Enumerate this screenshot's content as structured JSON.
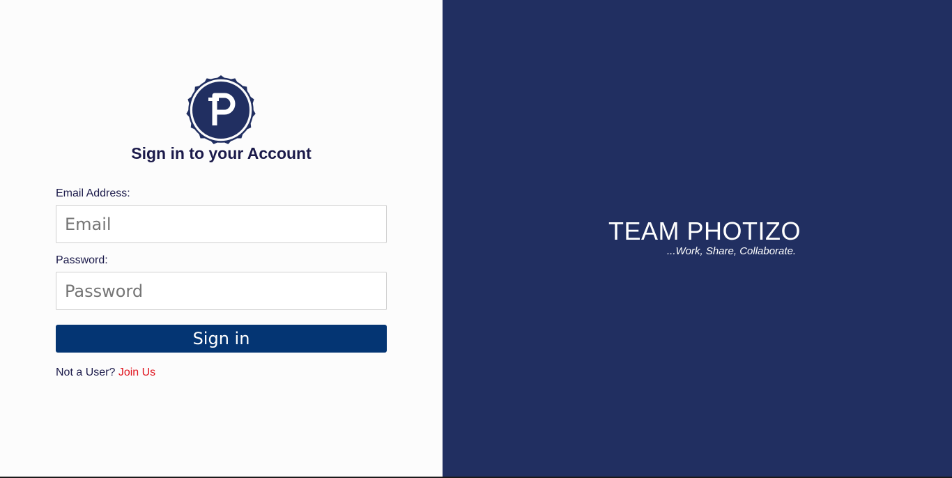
{
  "login": {
    "heading": "Sign in to your Account",
    "email_label": "Email Address:",
    "email_placeholder": "Email",
    "email_value": "",
    "password_label": "Password:",
    "password_placeholder": "Password",
    "password_value": "",
    "signin_label": "Sign in",
    "not_user_text": "Not a User?",
    "join_link": "Join Us",
    "logo_icon": "photizo-p-logo-icon"
  },
  "brand": {
    "title": "TEAM PHOTIZO",
    "tagline": "...Work, Share, Collaborate."
  },
  "colors": {
    "primary": "#212f61",
    "button": "#043573",
    "link": "#e0141e",
    "text": "#1b1a4a",
    "left_background": "#fcfcfc"
  }
}
